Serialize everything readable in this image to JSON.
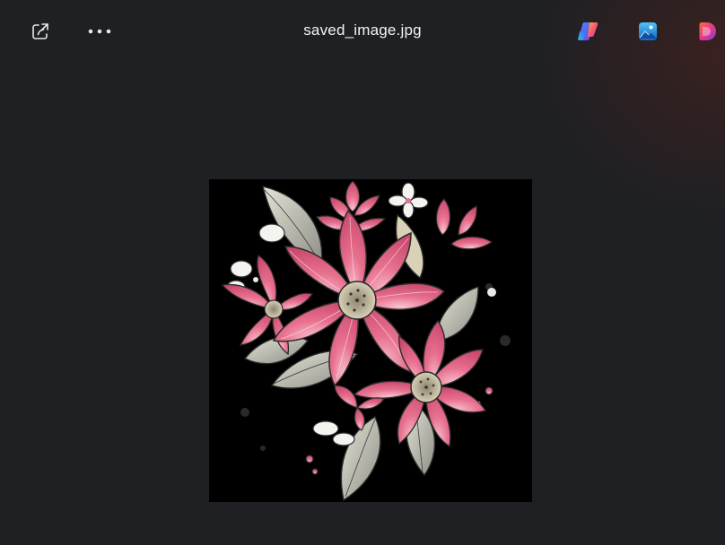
{
  "window": {
    "title": "saved_image.jpg"
  },
  "toolbar": {
    "share_icon": "share-icon",
    "more_icon": "more-options-icon",
    "copilot_icon": "copilot-icon",
    "photos_icon": "photos-app-icon",
    "designer_icon": "designer-icon"
  },
  "image": {
    "subject": "pink-flowers-illustration"
  },
  "colors": {
    "background": "#1f2024",
    "petal_pink": "#e8708f",
    "leaf_gray": "#b9b9ae",
    "flower_center": "#c9c2a8"
  }
}
